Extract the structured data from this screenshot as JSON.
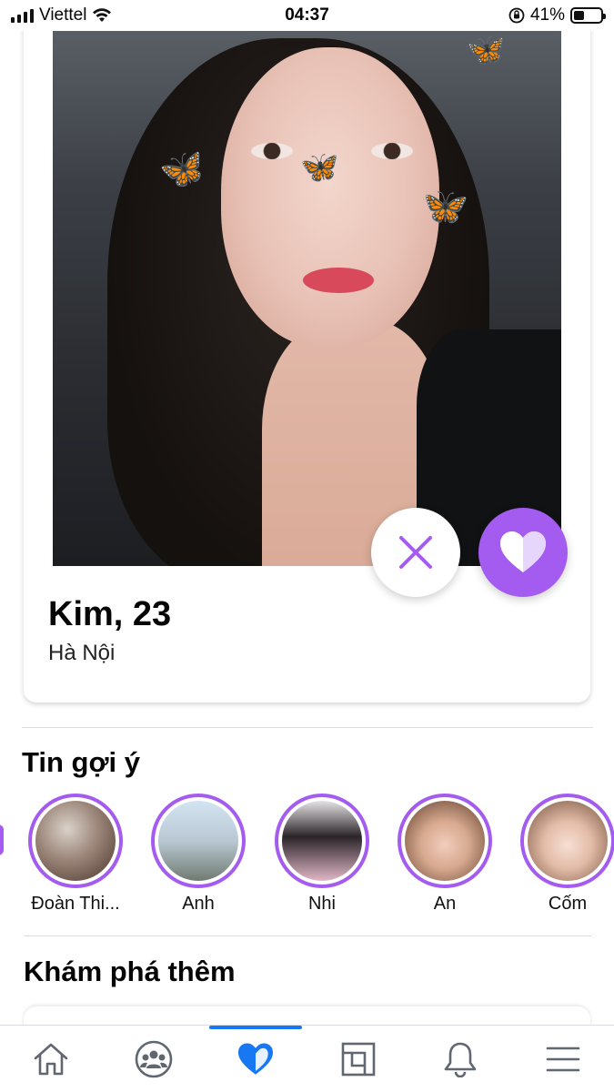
{
  "status_bar": {
    "carrier": "Viettel",
    "time": "04:37",
    "battery": "41%",
    "battery_level": 0.41
  },
  "profile": {
    "name_age": "Kim, 23",
    "city": "Hà Nội"
  },
  "actions": {
    "pass_icon": "close-icon",
    "like_icon": "heart-icon"
  },
  "suggested_stories": {
    "title": "Tin gợi ý",
    "items": [
      {
        "name": "Đoàn Thi..."
      },
      {
        "name": "Anh"
      },
      {
        "name": "Nhi"
      },
      {
        "name": "An"
      },
      {
        "name": "Cốm"
      }
    ]
  },
  "explore": {
    "title": "Khám phá thêm"
  },
  "bottom_nav": {
    "items": [
      "home-icon",
      "groups-icon",
      "dating-heart-icon",
      "marketplace-icon",
      "notifications-bell-icon",
      "menu-icon"
    ],
    "active": "dating-heart-icon"
  },
  "colors": {
    "accent": "#a45cf0",
    "fb_blue": "#1877f2"
  }
}
